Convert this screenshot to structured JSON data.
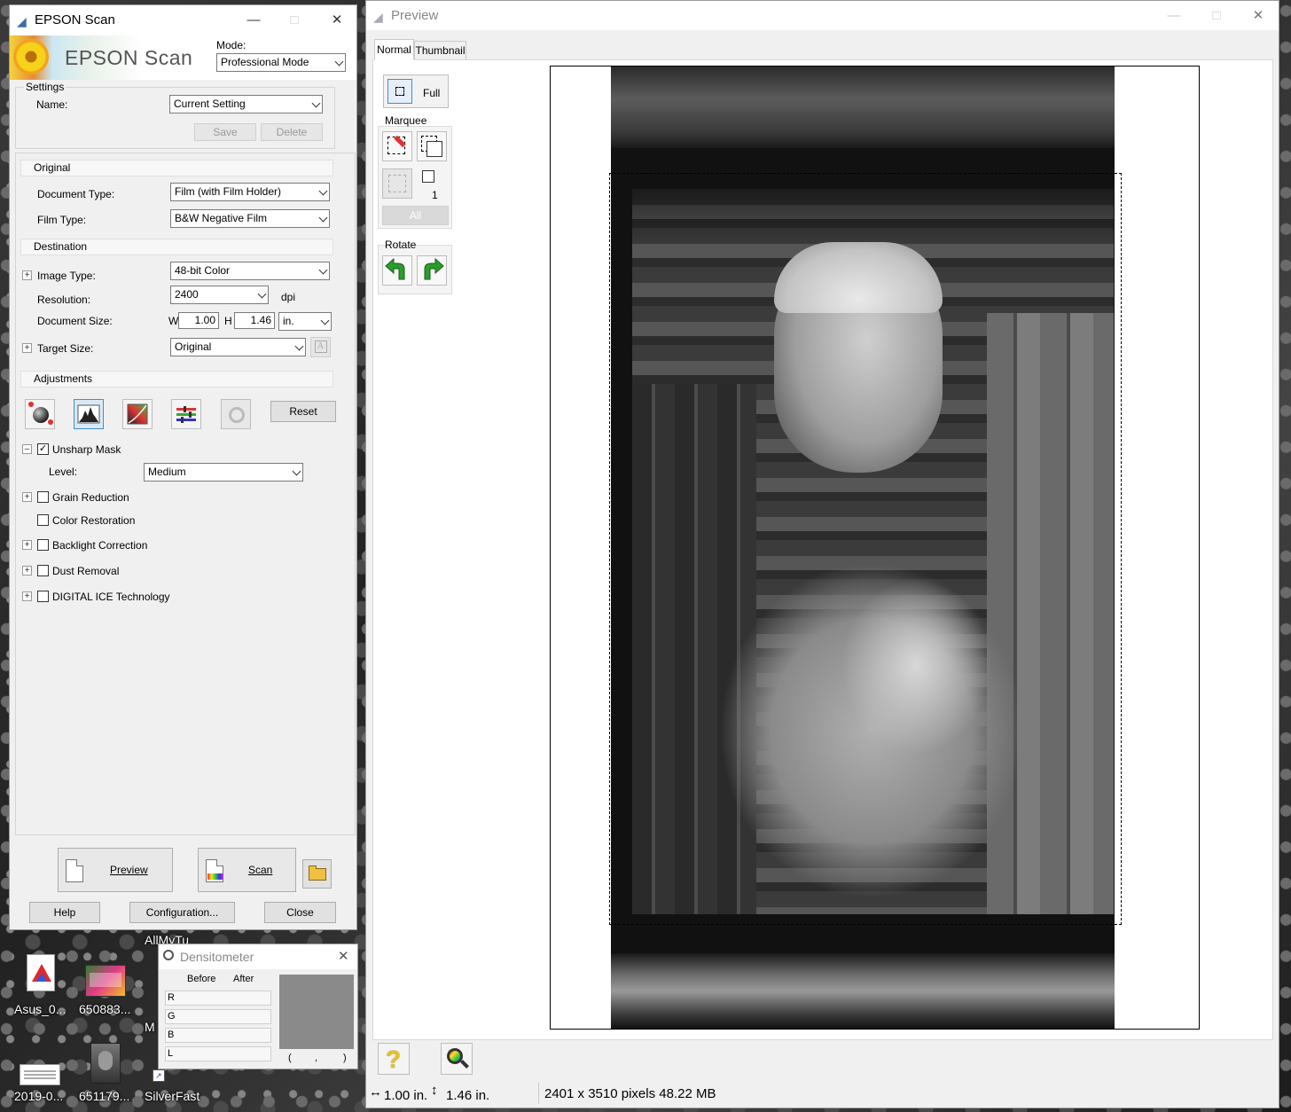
{
  "desktop": {
    "icons": [
      {
        "label": "Asus_0..."
      },
      {
        "label": "650883..."
      },
      {
        "label": "AllMyTu"
      },
      {
        "label": "M"
      },
      {
        "label": "2019-0..."
      },
      {
        "label": "651179..."
      },
      {
        "label": "SilverFast"
      }
    ]
  },
  "epson": {
    "title": "EPSON Scan",
    "logo": "EPSON Scan",
    "mode_label": "Mode:",
    "mode_value": "Professional Mode",
    "settings": {
      "group_label": "Settings",
      "name_label": "Name:",
      "name_value": "Current Setting",
      "save": "Save",
      "delete": "Delete"
    },
    "original": {
      "header": "Original",
      "document_type_label": "Document Type:",
      "document_type_value": "Film (with Film Holder)",
      "film_type_label": "Film Type:",
      "film_type_value": "B&W Negative Film"
    },
    "destination": {
      "header": "Destination",
      "image_type_label": "Image Type:",
      "image_type_value": "48-bit Color",
      "resolution_label": "Resolution:",
      "resolution_value": "2400",
      "resolution_unit": "dpi",
      "document_size_label": "Document Size:",
      "w_label": "W",
      "w_value": "1.00",
      "h_label": "H",
      "h_value": "1.46",
      "size_unit": "in.",
      "target_size_label": "Target Size:",
      "target_size_value": "Original"
    },
    "adjustments": {
      "header": "Adjustments",
      "reset": "Reset",
      "unsharp_mask": "Unsharp Mask",
      "unsharp_checked": true,
      "level_label": "Level:",
      "level_value": "Medium",
      "grain_reduction": "Grain Reduction",
      "color_restoration": "Color Restoration",
      "backlight_correction": "Backlight Correction",
      "dust_removal": "Dust Removal",
      "digital_ice": "DIGITAL ICE Technology"
    },
    "buttons": {
      "preview": "Preview",
      "scan": "Scan",
      "help": "Help",
      "configuration": "Configuration...",
      "close": "Close"
    }
  },
  "preview": {
    "title": "Preview",
    "tabs": [
      {
        "label": "Normal",
        "active": true
      },
      {
        "label": "Thumbnail",
        "active": false
      }
    ],
    "full_label": "Full",
    "marquee_label": "Marquee",
    "marquee_count": "1",
    "all_label": "All",
    "rotate_label": "Rotate",
    "status": {
      "width": "1.00 in.",
      "height": "1.46 in.",
      "info": "2401 x 3510 pixels 48.22 MB"
    }
  },
  "densitometer": {
    "title": "Densitometer",
    "before": "Before",
    "after": "After",
    "rows": [
      "R",
      "G",
      "B",
      "L"
    ],
    "coords_open": "(",
    "coords_sep": ",",
    "coords_close": ")"
  },
  "colors": {
    "accent": "#3d8fd4",
    "rotate_green": "#2a9d2a"
  }
}
